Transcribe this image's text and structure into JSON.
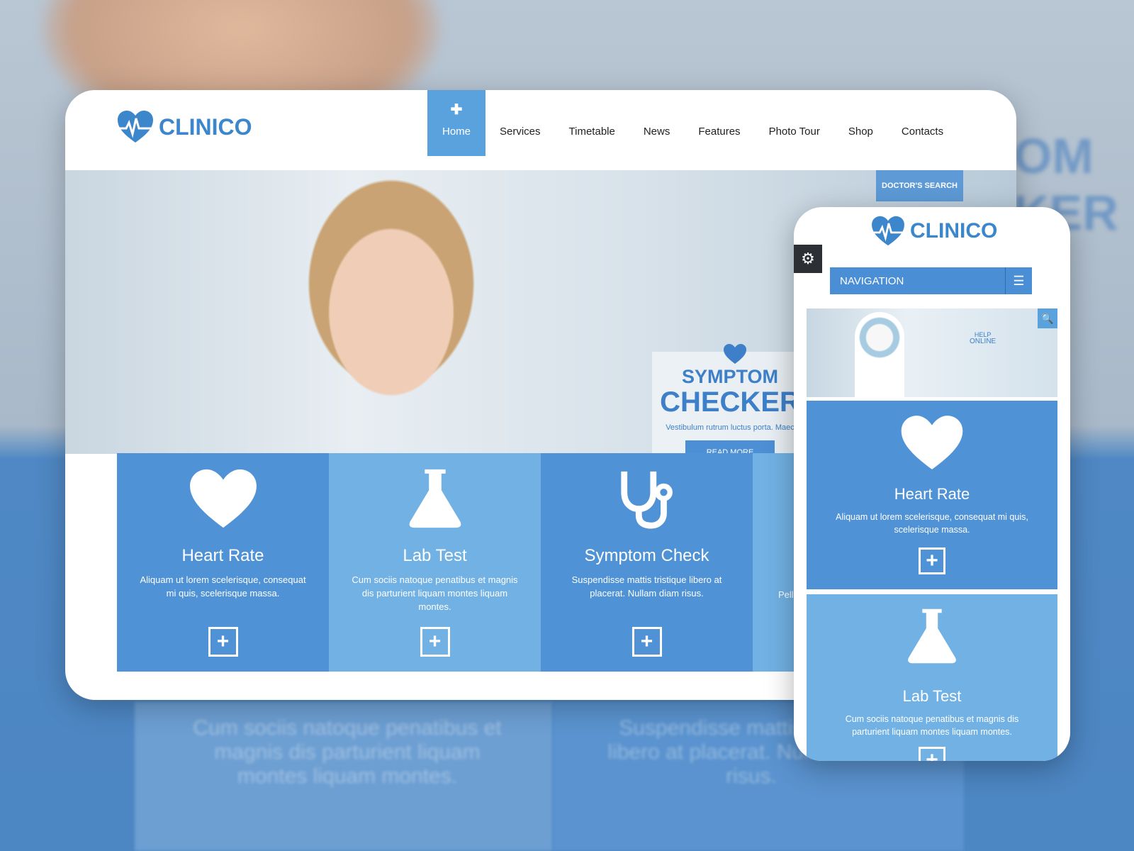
{
  "brand": {
    "name": "CLINICO",
    "accent": "#4a8fd6",
    "accent_light": "#71b1e4"
  },
  "desktop": {
    "nav": [
      {
        "label": "Home",
        "active": true,
        "icon": "plus-icon"
      },
      {
        "label": "Services"
      },
      {
        "label": "Timetable"
      },
      {
        "label": "News"
      },
      {
        "label": "Features"
      },
      {
        "label": "Photo Tour"
      },
      {
        "label": "Shop"
      },
      {
        "label": "Contacts"
      }
    ],
    "doctors_search": "DOCTOR'S SEARCH",
    "hero": {
      "title1": "SYMPTOM",
      "title2": "CHECKER",
      "text": "Vestibulum rutrum luctus porta. Maec",
      "button": "READ MORE"
    },
    "features": [
      {
        "icon": "heart-icon",
        "title": "Heart Rate",
        "text": "Aliquam ut lorem scelerisque, consequat mi quis, scelerisque massa."
      },
      {
        "icon": "flask-icon",
        "title": "Lab Test",
        "text": "Cum sociis natoque penatibus et magnis dis parturient liquam montes liquam montes."
      },
      {
        "icon": "stethoscope-icon",
        "title": "Symptom Check",
        "text": "Suspendisse mattis tristique libero at placerat. Nullam diam risus."
      },
      {
        "title": "",
        "text": "Pell"
      }
    ]
  },
  "mobile": {
    "nav_label": "NAVIGATION",
    "image_text": {
      "line1": "HELP",
      "line2": "ONLINE"
    },
    "features": [
      {
        "icon": "heart-icon",
        "title": "Heart Rate",
        "text": "Aliquam ut lorem scelerisque, consequat mi quis, scelerisque massa."
      },
      {
        "icon": "flask-icon",
        "title": "Lab Test",
        "text": "Cum sociis natoque penatibus et magnis dis parturient liquam montes liquam montes."
      }
    ]
  }
}
